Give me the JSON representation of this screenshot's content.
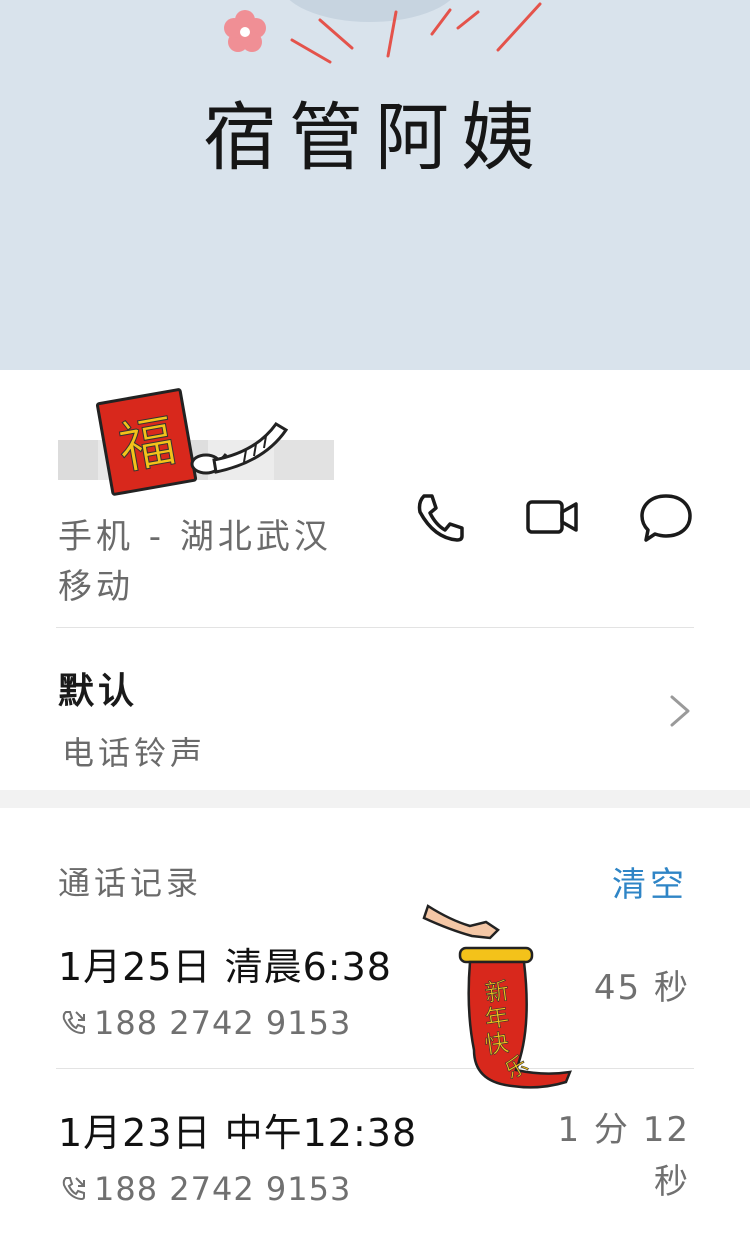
{
  "contact": {
    "name": "宿管阿姨",
    "number_hidden": "",
    "carrier": "手机 - 湖北武汉 移动"
  },
  "actions": {
    "call_icon": "phone-icon",
    "video_icon": "video-camera-icon",
    "message_icon": "chat-bubble-icon"
  },
  "ringtone": {
    "label": "默认",
    "sub": "电话铃声"
  },
  "call_log": {
    "title": "通话记录",
    "clear_label": "清空",
    "entries": [
      {
        "time": "1月25日  清晨6:38",
        "number": "188  2742  9153",
        "duration": "45 秒"
      },
      {
        "time": "1月23日  中午12:38",
        "number": "188  2742  9153",
        "duration": "1 分 12 秒"
      }
    ]
  },
  "stickers": {
    "fu_text": "福",
    "scroll_text": "新年快乐"
  },
  "colors": {
    "header_bg": "#d9e3ec",
    "accent": "#2f85c6",
    "sticker_red": "#d8281c",
    "sticker_gold": "#f3c21a"
  }
}
